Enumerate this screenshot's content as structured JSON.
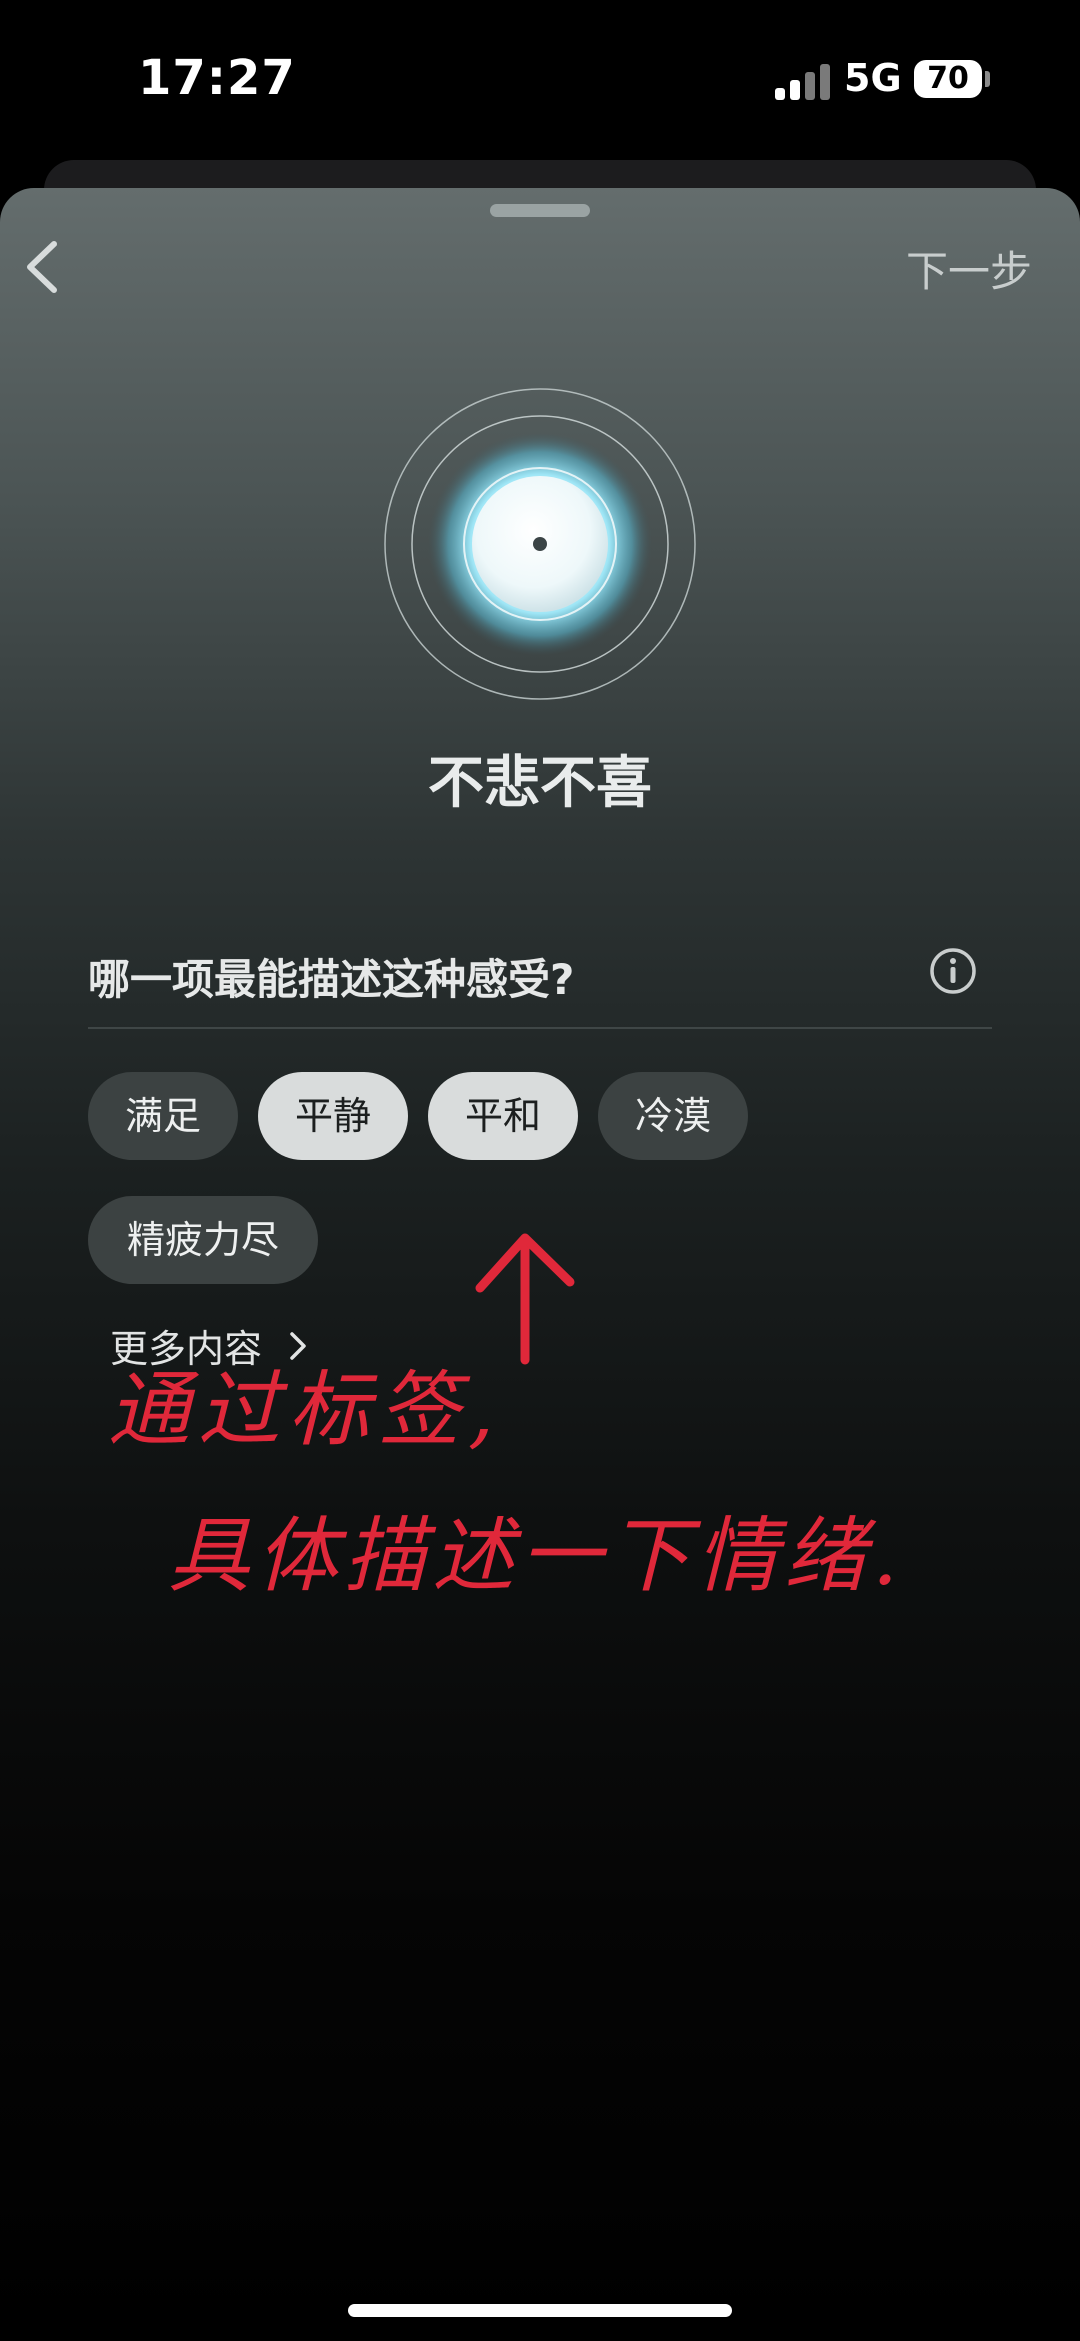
{
  "status_bar": {
    "time": "17:27",
    "network": "5G",
    "battery": "70"
  },
  "header": {
    "next_label": "下一步"
  },
  "mood": {
    "title": "不悲不喜"
  },
  "question": {
    "text": "哪一项最能描述这种感受?"
  },
  "tags": [
    {
      "label": "满足",
      "selected": false
    },
    {
      "label": "平静",
      "selected": true
    },
    {
      "label": "平和",
      "selected": true
    },
    {
      "label": "冷漠",
      "selected": false
    },
    {
      "label": "精疲力尽",
      "selected": false
    }
  ],
  "more": {
    "label": "更多内容"
  },
  "annotation": {
    "line1": "通过标签,",
    "line2": "具体描述一下情绪."
  },
  "colors": {
    "annotation": "#e0283a",
    "tag_selected": "#d9dcdc",
    "tag_unselected": "#3c4242"
  },
  "icons": [
    "back-chevron-icon",
    "info-icon",
    "chevron-right-icon",
    "arrow-up-icon",
    "mood-orb"
  ]
}
